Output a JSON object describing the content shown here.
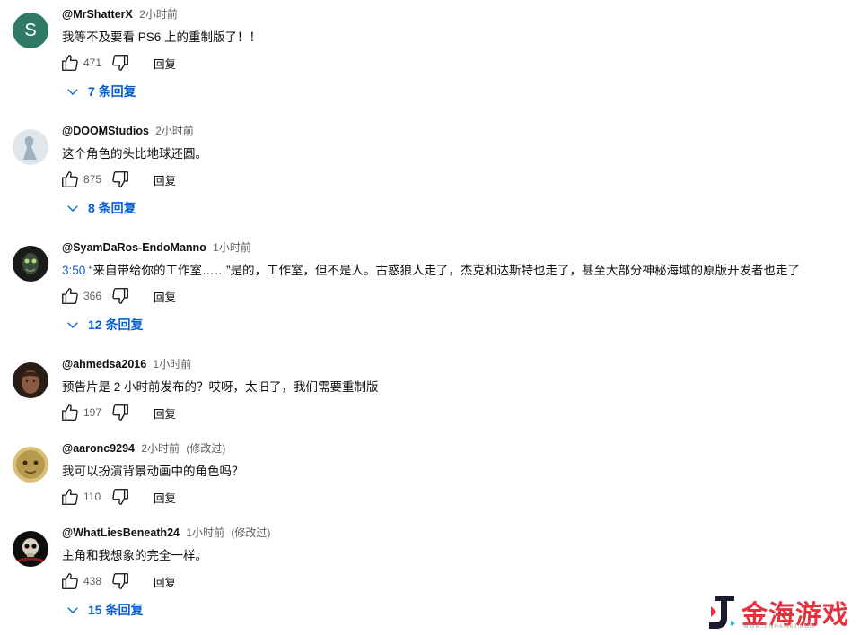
{
  "comments": [
    {
      "author": "@MrShatterX",
      "time": "2小时前",
      "edited": "",
      "timestamp": "",
      "text": "我等不及要看 PS6 上的重制版了！！",
      "likes": "471",
      "reply_label": "回复",
      "replies": "7 条回复",
      "avatar_letter": "S"
    },
    {
      "author": "@DOOMStudios",
      "time": "2小时前",
      "edited": "",
      "timestamp": "",
      "text": "这个角色的头比地球还圆。",
      "likes": "875",
      "reply_label": "回复",
      "replies": "8 条回复"
    },
    {
      "author": "@SyamDaRos-EndoManno",
      "time": "1小时前",
      "edited": "",
      "timestamp": "3:50",
      "text": " “来自带给你的工作室……”是的，工作室，但不是人。古惑狼人走了，杰克和达斯特也走了，甚至大部分神秘海域的原版开发者也走了",
      "likes": "366",
      "reply_label": "回复",
      "replies": "12 条回复"
    },
    {
      "author": "@ahmedsa2016",
      "time": "1小时前",
      "edited": "",
      "timestamp": "",
      "text": "预告片是 2 小时前发布的？哎呀，太旧了，我们需要重制版",
      "likes": "197",
      "reply_label": "回复",
      "replies": ""
    },
    {
      "author": "@aaronc9294",
      "time": "2小时前",
      "edited": "(修改过)",
      "timestamp": "",
      "text": "我可以扮演背景动画中的角色吗？",
      "likes": "110",
      "reply_label": "回复",
      "replies": ""
    },
    {
      "author": "@WhatLiesBeneath24",
      "time": "1小时前",
      "edited": "(修改过)",
      "timestamp": "",
      "text": "主角和我想象的完全一样。",
      "likes": "438",
      "reply_label": "回复",
      "replies": "15 条回复"
    }
  ],
  "icons": {
    "like": "thumb-up-icon",
    "dislike": "thumb-down-icon",
    "expand": "chevron-down-icon"
  },
  "colors": {
    "link": "#065fd4",
    "meta": "#606060",
    "watermark": "#e8313f"
  },
  "watermark": {
    "title": "金海游戏",
    "subtitle": "WWW.JINHAI668.COM"
  }
}
